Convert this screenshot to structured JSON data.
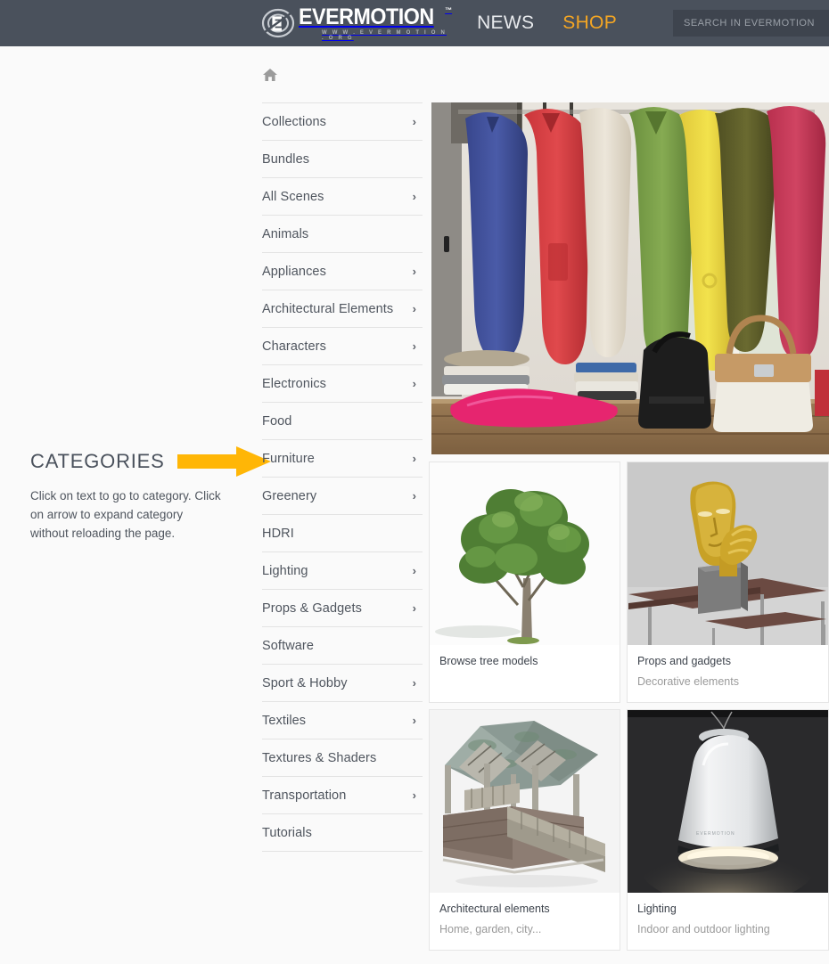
{
  "header": {
    "logo": {
      "main": "EVERMOTION",
      "tm": "™",
      "sub": "W W W . E V E R M O T I O N . O R G",
      "emblem_letter": "E"
    },
    "nav": [
      {
        "label": "NEWS",
        "active": false
      },
      {
        "label": "SHOP",
        "active": true
      }
    ],
    "search": {
      "placeholder": "SEARCH IN EVERMOTION SHOP",
      "value": ""
    },
    "background_color": "#4a515c",
    "accent_color": "#f5a623"
  },
  "annotation": {
    "title": "CATEGORIES",
    "body": "Click on text to go to category. Click on arrow to expand category without reloading the page.",
    "arrow_color": "#ffb606",
    "arrow_icon": "arrow-right-icon"
  },
  "breadcrumb": {
    "home_icon": "home-icon",
    "home_label": "Home"
  },
  "sidebar": {
    "items": [
      {
        "label": "Collections",
        "expandable": true
      },
      {
        "label": "Bundles",
        "expandable": false
      },
      {
        "label": "All Scenes",
        "expandable": true
      },
      {
        "label": "Animals",
        "expandable": false
      },
      {
        "label": "Appliances",
        "expandable": true
      },
      {
        "label": "Architectural Elements",
        "expandable": true
      },
      {
        "label": "Characters",
        "expandable": true
      },
      {
        "label": "Electronics",
        "expandable": true
      },
      {
        "label": "Food",
        "expandable": false
      },
      {
        "label": "Furniture",
        "expandable": true
      },
      {
        "label": "Greenery",
        "expandable": true
      },
      {
        "label": "HDRI",
        "expandable": false
      },
      {
        "label": "Lighting",
        "expandable": true
      },
      {
        "label": "Props & Gadgets",
        "expandable": true
      },
      {
        "label": "Software",
        "expandable": false
      },
      {
        "label": "Sport & Hobby",
        "expandable": true
      },
      {
        "label": "Textiles",
        "expandable": true
      },
      {
        "label": "Textures & Shaders",
        "expandable": false
      },
      {
        "label": "Transportation",
        "expandable": true
      },
      {
        "label": "Tutorials",
        "expandable": false
      }
    ],
    "chevron_glyph": "›"
  },
  "main": {
    "hero": {
      "alt": "Colorful coats hanging on hooks above bags and folded textiles"
    },
    "cards": [
      {
        "title": "Browse tree models",
        "subtitle": "",
        "image_alt": "Green deciduous tree on white background"
      },
      {
        "title": "Props and gadgets",
        "subtitle": "Decorative elements",
        "image_alt": "Gold face and hand sculpture on grey plinth"
      },
      {
        "title": "Architectural elements",
        "subtitle": "Home, garden, city...",
        "image_alt": "Wooden gazebo with ramp and shingled roof"
      },
      {
        "title": "Lighting",
        "subtitle": "Indoor and outdoor lighting",
        "image_alt": "White pendant lamp on dark background"
      }
    ]
  }
}
